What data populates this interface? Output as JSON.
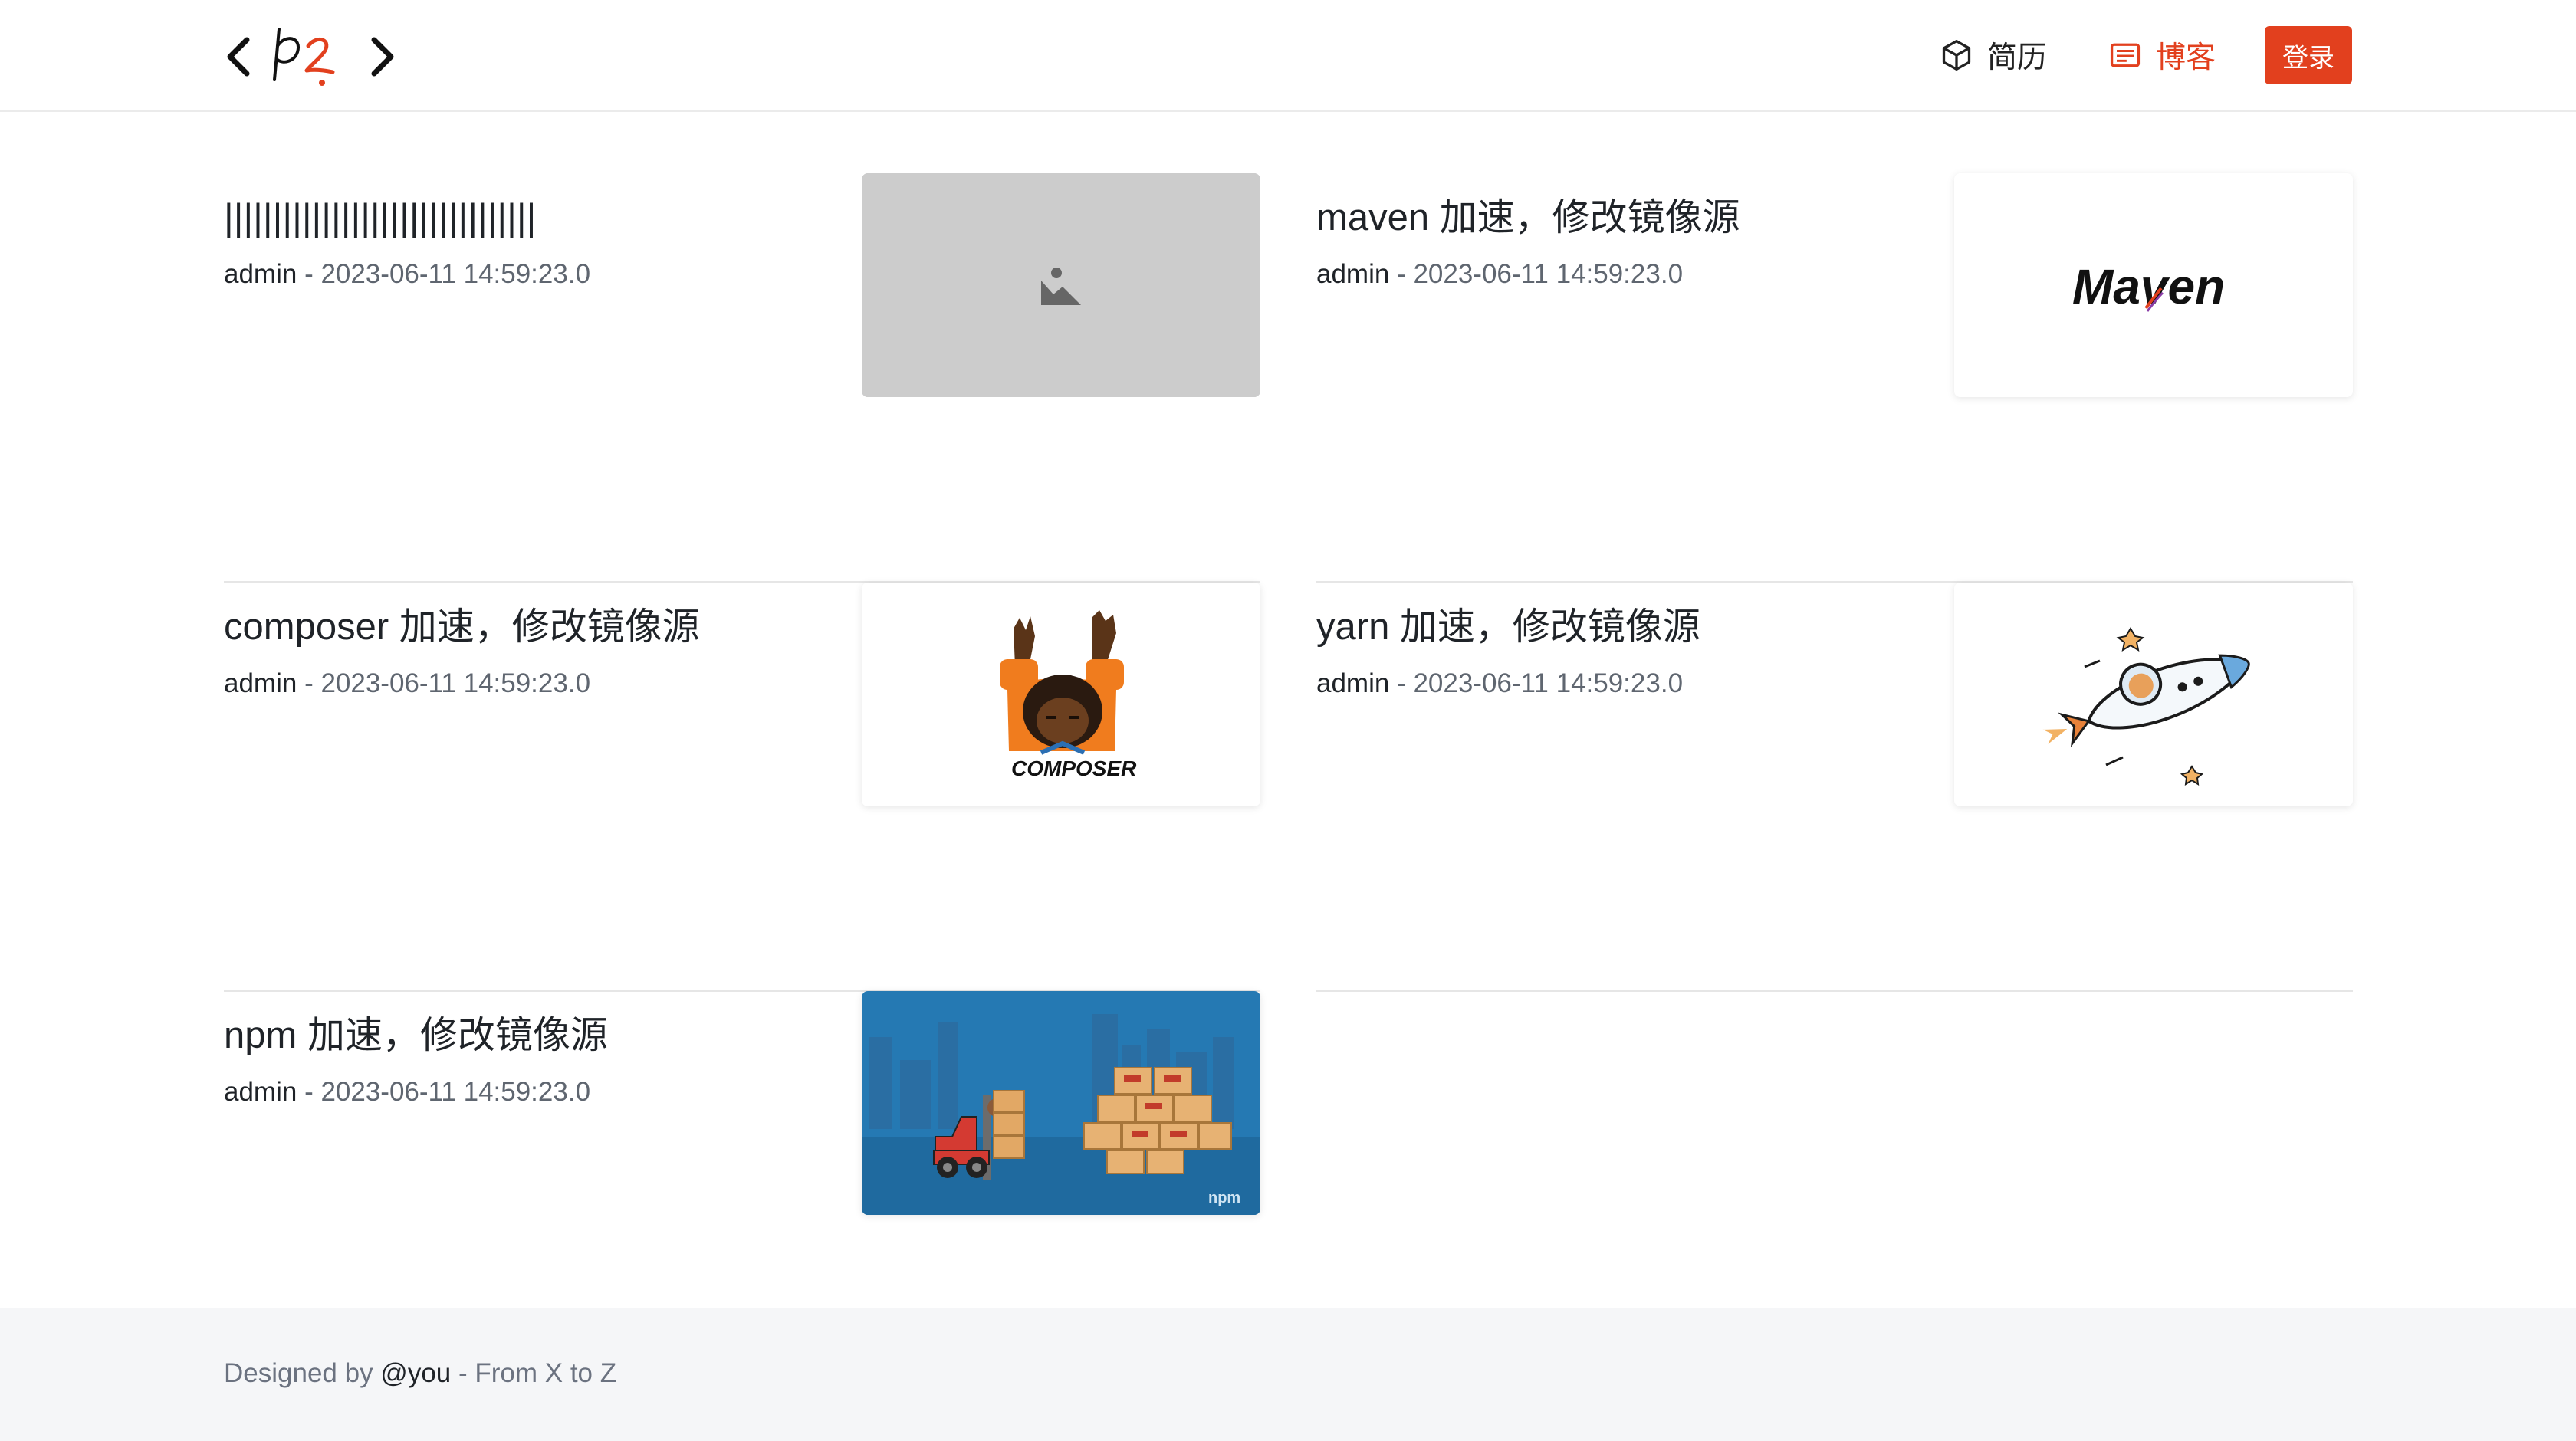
{
  "header": {
    "nav": [
      {
        "label": "简历",
        "icon": "cube-icon"
      },
      {
        "label": "博客",
        "icon": "document-lines-icon"
      }
    ],
    "login_label": "登录",
    "accent_color": "#e2401e"
  },
  "posts": [
    {
      "title": "||||||||||||||||||||||||||||||||",
      "author": "admin",
      "date": "- 2023-06-11 14:59:23.0",
      "thumbnail": "image-placeholder-icon"
    },
    {
      "title": "maven 加速，修改镜像源",
      "author": "admin",
      "date": "- 2023-06-11 14:59:23.0",
      "thumbnail": "maven-logo",
      "thumbnail_text": "Maven"
    },
    {
      "title": "composer 加速，修改镜像源",
      "author": "admin",
      "date": "- 2023-06-11 14:59:23.0",
      "thumbnail": "composer-logo",
      "thumbnail_text": "COMPOSER"
    },
    {
      "title": "yarn 加速，修改镜像源",
      "author": "admin",
      "date": "- 2023-06-11 14:59:23.0",
      "thumbnail": "yarn-rocket-illustration"
    },
    {
      "title": "npm 加速，修改镜像源",
      "author": "admin",
      "date": "- 2023-06-11 14:59:23.0",
      "thumbnail": "npm-forklift-illustration",
      "thumbnail_text": "npm"
    }
  ],
  "footer": {
    "prefix": "Designed by ",
    "link": "@you",
    "suffix": " - From X to Z"
  }
}
